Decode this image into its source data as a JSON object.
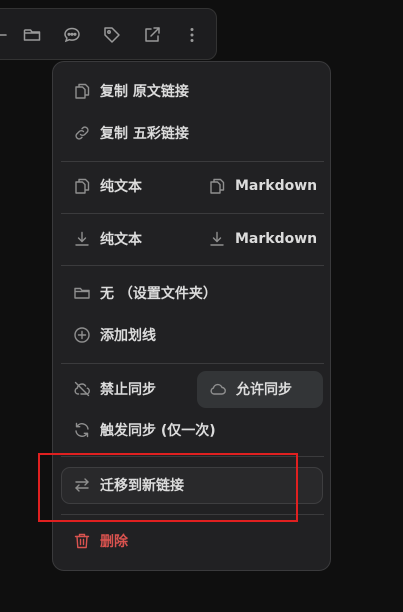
{
  "toolbar": {
    "icons": [
      "chevron-icon",
      "folder-icon",
      "comment-icon",
      "tag-icon",
      "external-link-icon",
      "more-vertical-icon"
    ]
  },
  "menu": {
    "copy_original": "复制 原文链接",
    "copy_wucai": "复制 五彩链接",
    "copy_plain": "纯文本",
    "copy_markdown": "Markdown",
    "download_plain": "纯文本",
    "download_markdown": "Markdown",
    "folder": "无 （设置文件夹）",
    "add_highlight": "添加划线",
    "disable_sync": "禁止同步",
    "allow_sync": "允许同步",
    "trigger_sync": "触发同步 (仅一次)",
    "migrate": "迁移到新链接",
    "delete": "删除"
  },
  "colors": {
    "background": "#0f0f0f",
    "menu_bg": "#212123",
    "danger": "#d9534f",
    "highlight_border": "#e02020"
  }
}
